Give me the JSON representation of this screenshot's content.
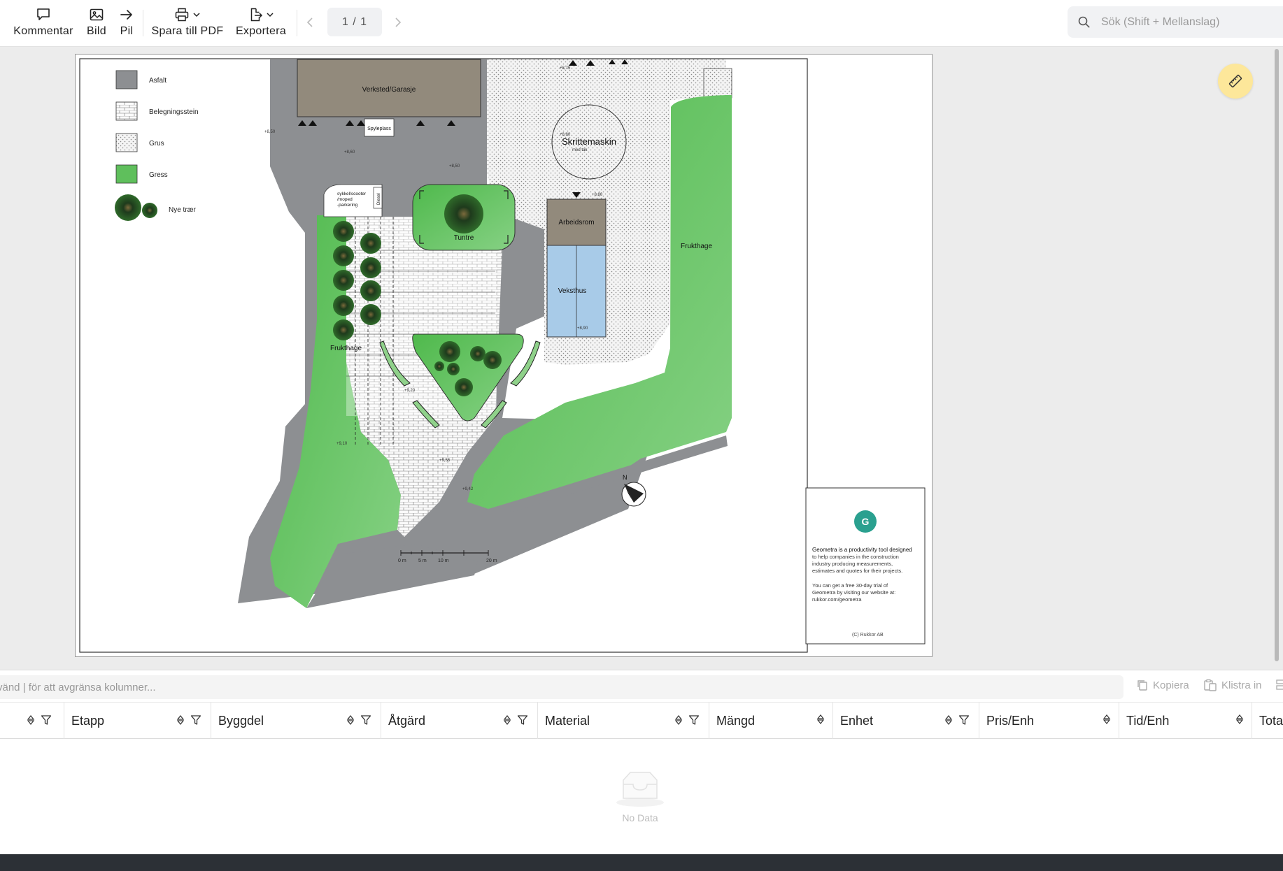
{
  "toolbar": {
    "comment_label": "Kommentar",
    "image_label": "Bild",
    "arrow_label": "Pil",
    "save_pdf_label": "Spara till PDF",
    "export_label": "Exportera",
    "page_indicator": "1 / 1",
    "search_placeholder": "Sök (Shift + Mellanslag)"
  },
  "drawing": {
    "legend": [
      "Asfalt",
      "Belegningsstein",
      "Grus",
      "Gress",
      "Nye trær"
    ],
    "labels": {
      "verksted": "Verksted/Garasje",
      "spyleplass": "Spyleplass",
      "skrittemaskin": "Skrittemaskin",
      "skrittemaskin_sub": "med tak",
      "arbeidsrom": "Arbeidsrom",
      "veksthus": "Veksthus",
      "frukthage_right": "Frukthage",
      "frukthage_left": "Frukthage",
      "tuntre": "Tuntre",
      "sykkel": [
        "sykkel/scooter",
        "/moped",
        "-parkering"
      ],
      "diesel": "Diesel"
    },
    "levels": [
      "+8,50",
      "+8,60",
      "+8,50",
      "+8,80",
      "+8,80",
      "+8,90",
      "+9,10",
      "+9,55",
      "+9,42",
      "+9,20",
      "+8,75"
    ],
    "scale_labels": [
      "0 m",
      "5 m",
      "10 m",
      "20 m"
    ],
    "north": "N",
    "title_block": {
      "logo_letter": "G",
      "text1_bold": "Geometra is a productivity tool designed",
      "text1": [
        "to help companies in the construction",
        "industry producing measurements,",
        "estimates and quotes for their projects."
      ],
      "text2": [
        "You can get a free 30-day trial of",
        "Geometra by visiting our website at:",
        "rukkor.com/geometra"
      ],
      "copyright": "(C) Rukkor AB"
    }
  },
  "filter": {
    "placeholder": "vänd | för att avgränsa kolumner...",
    "copy_label": "Kopiera",
    "paste_label": "Klistra in"
  },
  "table": {
    "columns": [
      "Etapp",
      "Byggdel",
      "Åtgärd",
      "Material",
      "Mängd",
      "Enhet",
      "Pris/Enh",
      "Tid/Enh",
      "Tota"
    ],
    "empty_text": "No Data"
  },
  "colors": {
    "asphalt": "#8d8f92",
    "grass": "#6cc86a",
    "building": "#928a7c",
    "greenhouse": "#a8cbe8",
    "accent": "#2aa08f",
    "ruler_button": "#fde79a"
  }
}
